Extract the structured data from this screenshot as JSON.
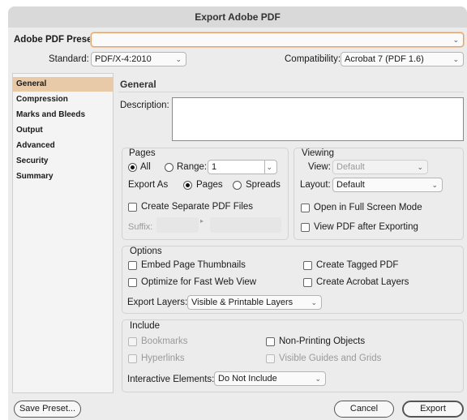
{
  "window": {
    "title": "Export Adobe PDF"
  },
  "preset": {
    "label": "Adobe PDF Preset:",
    "value": ""
  },
  "standard": {
    "label": "Standard:",
    "value": "PDF/X-4:2010"
  },
  "compatibility": {
    "label": "Compatibility:",
    "value": "Acrobat 7 (PDF 1.6)"
  },
  "sidebar": {
    "items": [
      {
        "label": "General",
        "selected": true
      },
      {
        "label": "Compression"
      },
      {
        "label": "Marks and Bleeds"
      },
      {
        "label": "Output"
      },
      {
        "label": "Advanced"
      },
      {
        "label": "Security"
      },
      {
        "label": "Summary"
      }
    ]
  },
  "main": {
    "heading": "General",
    "description_label": "Description:",
    "description_value": ""
  },
  "pages": {
    "title": "Pages",
    "all_label": "All",
    "range_label": "Range:",
    "range_value": "1",
    "export_as_label": "Export As",
    "pages_option": "Pages",
    "spreads_option": "Spreads",
    "separate_files_label": "Create Separate PDF Files",
    "suffix_label": "Suffix:"
  },
  "viewing": {
    "title": "Viewing",
    "view_label": "View:",
    "view_value": "Default",
    "layout_label": "Layout:",
    "layout_value": "Default",
    "fullscreen_label": "Open in Full Screen Mode",
    "view_after_label": "View PDF after Exporting"
  },
  "options": {
    "title": "Options",
    "embed_thumbnails": "Embed Page Thumbnails",
    "optimize_web": "Optimize for Fast Web View",
    "tagged_pdf": "Create Tagged PDF",
    "acrobat_layers": "Create Acrobat Layers",
    "export_layers_label": "Export Layers:",
    "export_layers_value": "Visible & Printable Layers"
  },
  "include": {
    "title": "Include",
    "bookmarks": "Bookmarks",
    "hyperlinks": "Hyperlinks",
    "non_printing": "Non-Printing Objects",
    "guides_grids": "Visible Guides and Grids",
    "interactive_label": "Interactive Elements:",
    "interactive_value": "Do Not Include"
  },
  "footer": {
    "save_preset": "Save Preset...",
    "cancel": "Cancel",
    "export": "Export"
  },
  "colors": {
    "selection": "#e8c9a8",
    "focus": "#e0a36e"
  },
  "icons": {
    "popup": "chevron-down-icon"
  }
}
